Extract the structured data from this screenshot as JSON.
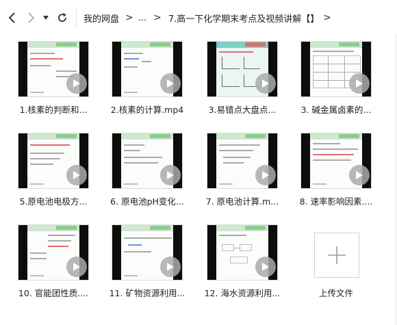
{
  "nav": {
    "back_icon": "chevron-left-icon",
    "forward_icon": "chevron-right-icon",
    "dropdown_icon": "caret-down-icon",
    "refresh_icon": "refresh-icon"
  },
  "breadcrumb": {
    "root": "我的网盘",
    "ellipsis": "...",
    "current": "7.高一下化学期末考点及视频讲解【】"
  },
  "files": [
    {
      "name": "1.核素的判断和...",
      "type": "video"
    },
    {
      "name": "2.核素的计算.mp4",
      "type": "video"
    },
    {
      "name": "3.易错点大盘点...",
      "type": "video"
    },
    {
      "name": "3. 碱金属卤素的...",
      "type": "video"
    },
    {
      "name": "5.原电池电极方...",
      "type": "video"
    },
    {
      "name": "6. 原电池pH变化...",
      "type": "video"
    },
    {
      "name": "7. 原电池计算.m...",
      "type": "video"
    },
    {
      "name": "8. 速率影响因素....",
      "type": "video"
    },
    {
      "name": "10. 官能团性质....",
      "type": "video"
    },
    {
      "name": "11. 矿物资源利用...",
      "type": "video"
    },
    {
      "name": "12. 海水资源利用...",
      "type": "video"
    }
  ],
  "upload": {
    "label": "上传文件",
    "icon": "plus-icon"
  },
  "colors": {
    "slide_band": "#cfe8cf",
    "play_overlay": "#aaaaaa",
    "text": "#222222"
  }
}
